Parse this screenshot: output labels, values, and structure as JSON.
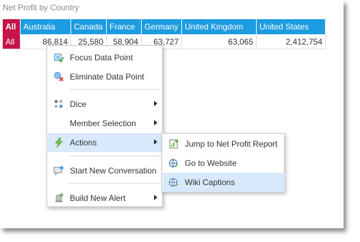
{
  "panel": {
    "title": "Net Profit by Country"
  },
  "table": {
    "all_label": "All",
    "columns": [
      "Australia",
      "Canada",
      "France",
      "Germany",
      "United Kingdom",
      "United States"
    ],
    "row": {
      "label": "All",
      "values": [
        "86,814",
        "25,580",
        "58,904",
        "63,727",
        "63,065",
        "2,412,754"
      ]
    }
  },
  "context_menu": {
    "items": [
      {
        "label": "Focus Data Point",
        "icon": "focus-data-point-icon"
      },
      {
        "label": "Eliminate Data Point",
        "icon": "eliminate-data-point-icon"
      },
      {
        "label": "Dice",
        "icon": "dice-icon",
        "submenu": true
      },
      {
        "label": "Member Selection",
        "icon": "none",
        "submenu": true
      },
      {
        "label": "Actions",
        "icon": "lightning-icon",
        "submenu": true,
        "active": true
      },
      {
        "label": "Start New Conversation",
        "icon": "conversation-icon"
      },
      {
        "label": "Build New Alert",
        "icon": "alert-bell-icon",
        "submenu": true
      }
    ]
  },
  "actions_submenu": {
    "items": [
      {
        "label": "Jump to Net Profit Report",
        "icon": "report-jump-icon"
      },
      {
        "label": "Go to Website",
        "icon": "globe-icon"
      },
      {
        "label": "Wiki Captions",
        "icon": "globe-icon",
        "hovered": true
      }
    ]
  },
  "colors": {
    "header_blue": "#1e9ce0",
    "all_crimson": "#c41449",
    "hover": "#d7e9fa"
  }
}
